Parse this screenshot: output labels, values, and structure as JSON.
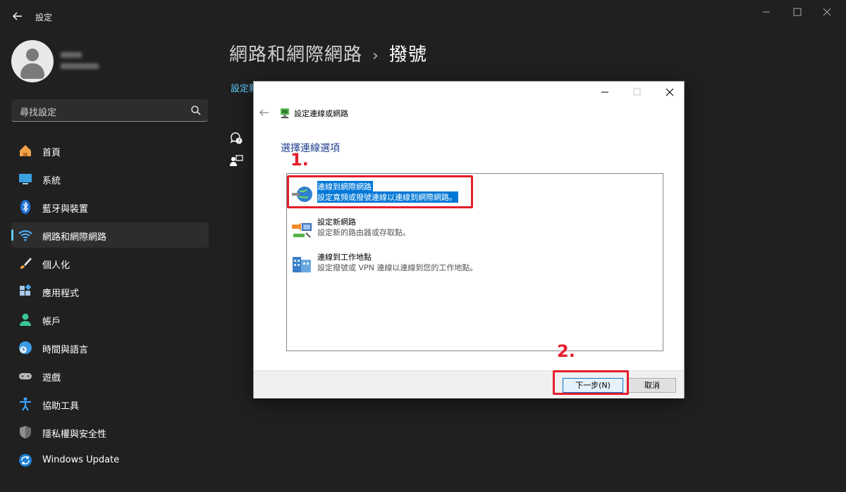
{
  "window": {
    "title": "設定"
  },
  "search": {
    "placeholder": "尋找設定"
  },
  "nav": {
    "items": [
      {
        "label": "首頁"
      },
      {
        "label": "系統"
      },
      {
        "label": "藍牙與裝置"
      },
      {
        "label": "網路和網際網路",
        "active": true
      },
      {
        "label": "個人化"
      },
      {
        "label": "應用程式"
      },
      {
        "label": "帳戶"
      },
      {
        "label": "時間與語言"
      },
      {
        "label": "遊戲"
      },
      {
        "label": "協助工具"
      },
      {
        "label": "隱私權與安全性"
      },
      {
        "label": "Windows Update"
      }
    ]
  },
  "main": {
    "breadcrumb_parent": "網路和網際網路",
    "breadcrumb_separator": "›",
    "breadcrumb_current": "撥號",
    "link_text": "設定新"
  },
  "dialog": {
    "title": "設定連線或網路",
    "heading": "選擇連線選項",
    "options": [
      {
        "title": "連線到網際網路",
        "desc": "設定寬頻或撥號連線以連線到網際網路。",
        "selected": true
      },
      {
        "title": "設定新網路",
        "desc": "設定新的路由器或存取點。",
        "selected": false
      },
      {
        "title": "連線到工作地點",
        "desc": "設定撥號或 VPN 連線以連線到您的工作地點。",
        "selected": false
      }
    ],
    "next_label": "下一步(N)",
    "cancel_label": "取消"
  },
  "annotations": {
    "step1": "1.",
    "step2": "2."
  },
  "colors": {
    "accent": "#60cdff",
    "selection": "#0078d7",
    "annotation": "#e41e2b",
    "background": "#202020"
  }
}
